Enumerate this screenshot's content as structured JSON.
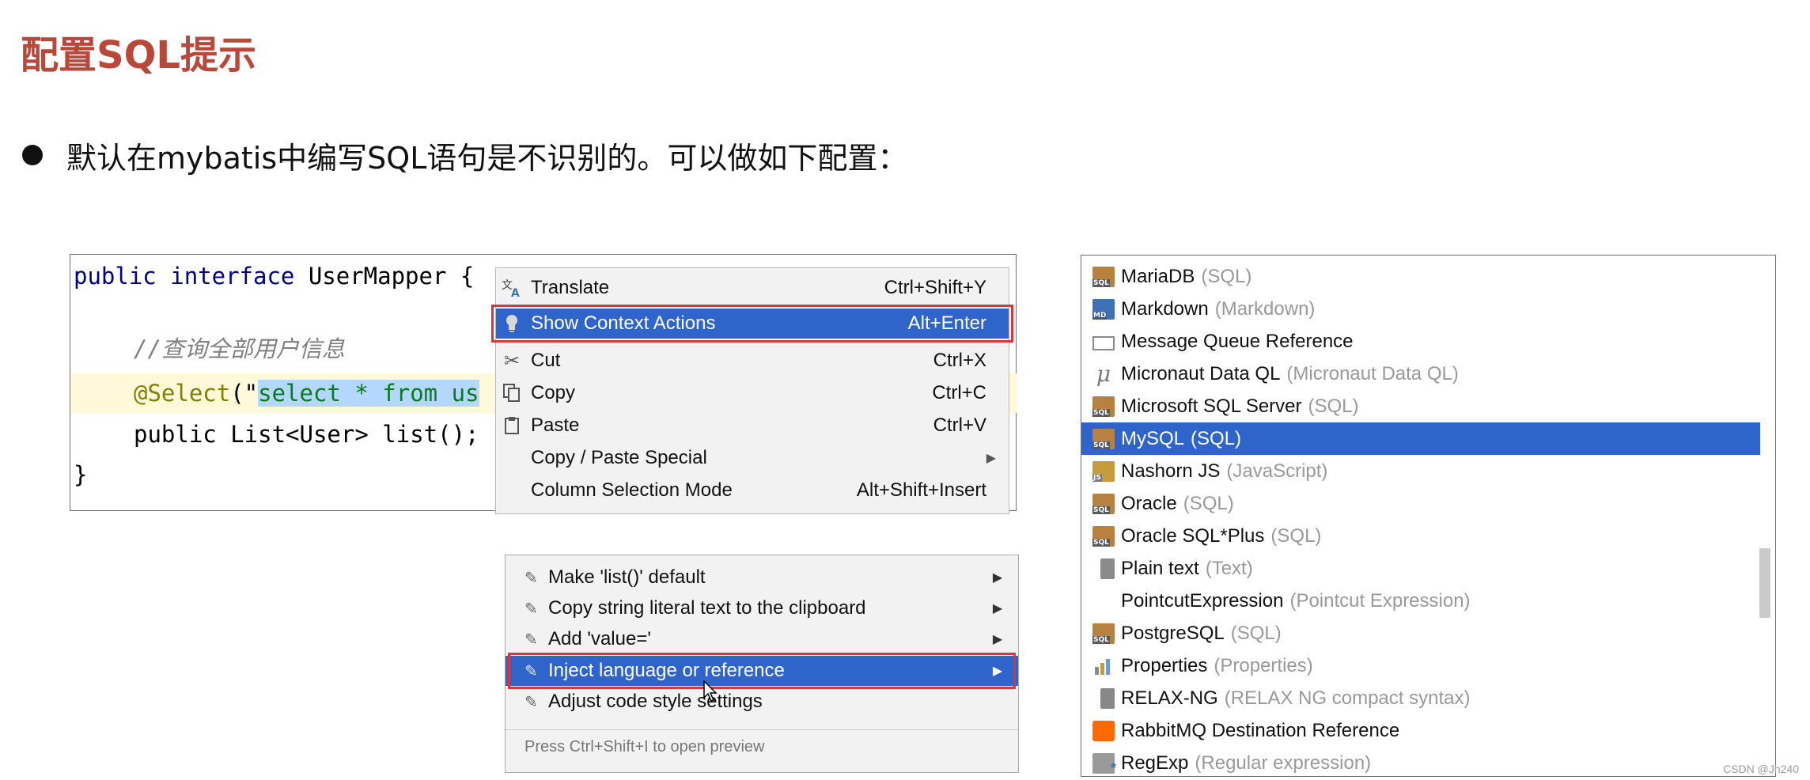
{
  "slide": {
    "title": "配置SQL提示",
    "bullet": "默认在mybatis中编写SQL语句是不识别的。可以做如下配置："
  },
  "editor": {
    "line1_kw1": "public",
    "line1_kw2": "interface",
    "line1_rest": " UserMapper {",
    "line2_comment": "//查询全部用户信息",
    "line3_annot": "@Select",
    "line3_paren": "(\"",
    "line3_selected": "select * from us",
    "line4_text": "public List<User> list();",
    "line5_text": "}"
  },
  "context_menu": {
    "items": [
      {
        "icon": "translate-icon",
        "label": "Translate",
        "shortcut": "Ctrl+Shift+Y"
      },
      {
        "icon": "lightbulb-icon",
        "label": "Show Context Actions",
        "shortcut": "Alt+Enter",
        "active": true
      },
      {
        "icon": "scissors-icon",
        "label": "Cut",
        "shortcut": "Ctrl+X"
      },
      {
        "icon": "copy-icon",
        "label": "Copy",
        "shortcut": "Ctrl+C"
      },
      {
        "icon": "clipboard-icon",
        "label": "Paste",
        "shortcut": "Ctrl+V"
      },
      {
        "icon": "",
        "label": "Copy / Paste Special",
        "shortcut": "",
        "submenu": true
      },
      {
        "icon": "",
        "label": "Column Selection Mode",
        "shortcut": "Alt+Shift+Insert"
      }
    ]
  },
  "intent_menu": {
    "items": [
      {
        "icon": "intention-icon",
        "label": "Make 'list()' default"
      },
      {
        "icon": "intention-icon",
        "label": "Copy string literal text to the clipboard"
      },
      {
        "icon": "intention-icon",
        "label": "Add 'value='"
      },
      {
        "icon": "intention-icon",
        "label": "Inject language or reference",
        "active": true
      },
      {
        "icon": "intention-icon",
        "label": "Adjust code style settings"
      }
    ],
    "footer": "Press Ctrl+Shift+I to open preview"
  },
  "languages": [
    {
      "icon": "sql",
      "name": "MariaDB",
      "detail": "(SQL)"
    },
    {
      "icon": "md",
      "name": "Markdown",
      "detail": "(Markdown)"
    },
    {
      "icon": "mq",
      "name": "Message Queue Reference",
      "detail": ""
    },
    {
      "icon": "mu",
      "name": "Micronaut Data QL",
      "detail": "(Micronaut Data QL)"
    },
    {
      "icon": "sql",
      "name": "Microsoft SQL Server",
      "detail": "(SQL)"
    },
    {
      "icon": "sql",
      "name": "MySQL",
      "detail": "(SQL)",
      "active": true
    },
    {
      "icon": "js",
      "name": "Nashorn JS",
      "detail": "(JavaScript)"
    },
    {
      "icon": "sql",
      "name": "Oracle",
      "detail": "(SQL)"
    },
    {
      "icon": "sql",
      "name": "Oracle SQL*Plus",
      "detail": "(SQL)"
    },
    {
      "icon": "txt",
      "name": "Plain text",
      "detail": "(Text)"
    },
    {
      "icon": "",
      "name": "PointcutExpression",
      "detail": "(Pointcut Expression)"
    },
    {
      "icon": "sql",
      "name": "PostgreSQL",
      "detail": "(SQL)"
    },
    {
      "icon": "props",
      "name": "Properties",
      "detail": "(Properties)"
    },
    {
      "icon": "relax",
      "name": "RELAX-NG",
      "detail": "(RELAX NG compact syntax)"
    },
    {
      "icon": "rabbit",
      "name": "RabbitMQ Destination Reference",
      "detail": ""
    },
    {
      "icon": "regex",
      "name": "RegExp",
      "detail": "(Regular expression)"
    }
  ],
  "watermark": "CSDN @Jh240",
  "colors": {
    "title": "#b8483a",
    "selection": "#2f65ca",
    "highlight_frame": "#d8363b"
  }
}
